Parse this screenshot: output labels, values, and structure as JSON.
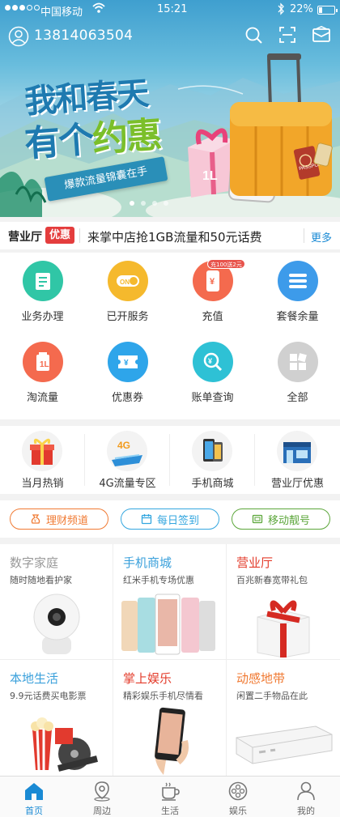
{
  "status_bar": {
    "carrier": "中国移动",
    "time": "15:21",
    "battery": "22%"
  },
  "header": {
    "phone": "13814063504"
  },
  "banner": {
    "title_line1": "我和春天",
    "title_line2a": "有个",
    "title_line2b": "约惠",
    "ribbon": "爆款流量锦囊在手",
    "slide_count": 4,
    "active_slide": 1
  },
  "notice": {
    "brand_a": "营业厅",
    "brand_b": "优惠",
    "text": "来掌中店抢1GB流量和50元话费",
    "more": "更多"
  },
  "services": [
    {
      "label": "业务办理",
      "icon": "form-icon",
      "color": "#30c6a6"
    },
    {
      "label": "已开服务",
      "icon": "toggle-on-icon",
      "color": "#f5b92d"
    },
    {
      "label": "充值",
      "icon": "phone-yen-icon",
      "color": "#f46a4e",
      "badge": "充100送2元"
    },
    {
      "label": "套餐余量",
      "icon": "list-icon",
      "color": "#3d9bea"
    },
    {
      "label": "淘流量",
      "icon": "flow-icon",
      "color": "#f46a4e"
    },
    {
      "label": "优惠券",
      "icon": "coupon-icon",
      "color": "#2ea5ea"
    },
    {
      "label": "账单查询",
      "icon": "bill-search-icon",
      "color": "#2ec1d5"
    },
    {
      "label": "全部",
      "icon": "grid-icon",
      "color": "#d0d0d0"
    }
  ],
  "promos": [
    {
      "label": "当月热销"
    },
    {
      "label": "4G流量专区"
    },
    {
      "label": "手机商城"
    },
    {
      "label": "营业厅优惠"
    }
  ],
  "pills": [
    {
      "label": "理财频道",
      "icon": "money-bag-icon",
      "color": "#f07a33"
    },
    {
      "label": "每日签到",
      "icon": "calendar-icon",
      "color": "#33a6df"
    },
    {
      "label": "移动靓号",
      "icon": "sim-card-icon",
      "color": "#5ba63a"
    }
  ],
  "tiles": [
    {
      "title": "数字家庭",
      "sub": "随时随地看护家",
      "color": "#999999"
    },
    {
      "title": "手机商城",
      "sub": "红米手机专场优惠",
      "color": "#3aa0db"
    },
    {
      "title": "营业厅",
      "sub": "百兆新春宽带礼包",
      "color": "#e33b2a"
    },
    {
      "title": "本地生活",
      "sub": "9.9元话费买电影票",
      "color": "#3aa0db"
    },
    {
      "title": "掌上娱乐",
      "sub": "精彩娱乐手机尽情看",
      "color": "#e33b2a"
    },
    {
      "title": "动感地带",
      "sub": "闲置二手物品在此",
      "color": "#f07a33"
    }
  ],
  "nav": [
    {
      "label": "首页",
      "icon": "home-icon",
      "active": true
    },
    {
      "label": "周边",
      "icon": "location-icon",
      "active": false
    },
    {
      "label": "生活",
      "icon": "coffee-icon",
      "active": false
    },
    {
      "label": "娱乐",
      "icon": "film-reel-icon",
      "active": false
    },
    {
      "label": "我的",
      "icon": "person-icon",
      "active": false
    }
  ]
}
